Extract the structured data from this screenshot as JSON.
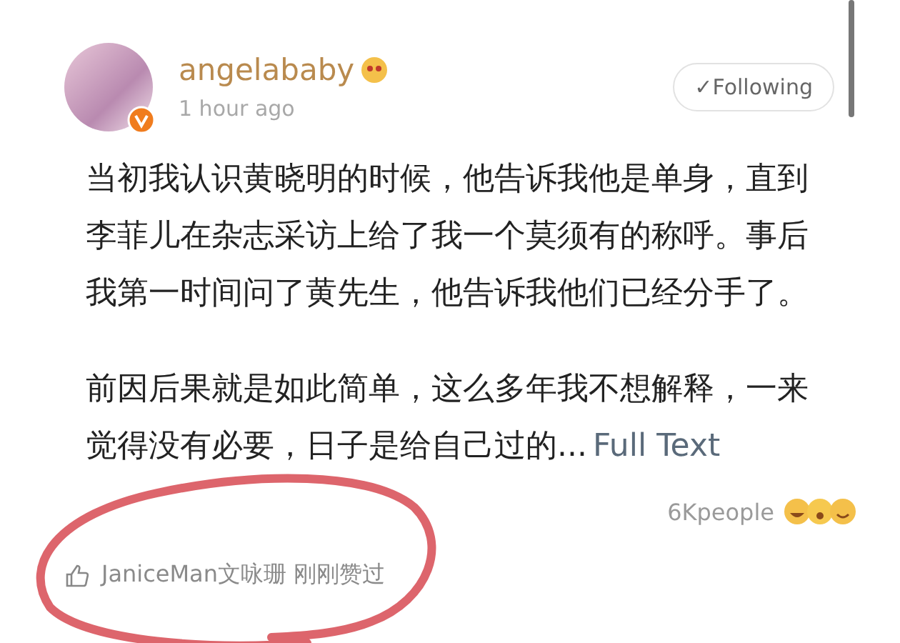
{
  "post": {
    "author": "angelababy",
    "time": "1 hour ago",
    "follow_button": {
      "label": "✓Following",
      "selected": true
    },
    "paragraphs": [
      "当初我认识黄晓明的时候，他告诉我他是单身，直到李菲儿在杂志采访上给了我一个莫须有的称呼。事后我第一时间问了黄先生，他告诉我他们已经分手了。",
      "前因后果就是如此简单，这么多年我不想解释，一来觉得没有必要，日子是给自己过的..."
    ],
    "full_text_link": "Full Text",
    "reactions": "6Kpeople",
    "liked_by": {
      "user": "JaniceMan文咏珊",
      "action": "刚刚赞过"
    }
  }
}
